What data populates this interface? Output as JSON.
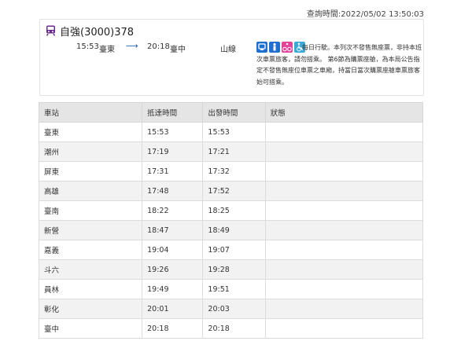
{
  "query_time": "查詢時間:2022/05/02 13:50:03",
  "train": {
    "name": "自強(3000)378",
    "depart_time": "15:53",
    "depart_station": "臺東",
    "arrive_time": "20:18",
    "arrive_station": "臺中",
    "line": "山線",
    "service_icons": [
      "wifi-icon",
      "family-icon",
      "bicycle-icon",
      "wheelchair-icon"
    ],
    "note": "每日行駛。本列次不發售無座票，非持本班次車票旅客，請勿搭乘。 第6節為購票座艙，為本局公告指定不發售無座位車票之車廂，持當日當次購票座艙車票旅客始可搭乘。"
  },
  "table": {
    "headers": [
      "車站",
      "抵達時間",
      "出發時間",
      "狀態"
    ],
    "rows": [
      {
        "station": "臺東",
        "arrive": "15:53",
        "depart": "15:53",
        "status": ""
      },
      {
        "station": "潮州",
        "arrive": "17:19",
        "depart": "17:21",
        "status": ""
      },
      {
        "station": "屏東",
        "arrive": "17:31",
        "depart": "17:32",
        "status": ""
      },
      {
        "station": "高雄",
        "arrive": "17:48",
        "depart": "17:52",
        "status": ""
      },
      {
        "station": "臺南",
        "arrive": "18:22",
        "depart": "18:25",
        "status": ""
      },
      {
        "station": "新營",
        "arrive": "18:47",
        "depart": "18:49",
        "status": ""
      },
      {
        "station": "嘉義",
        "arrive": "19:04",
        "depart": "19:07",
        "status": ""
      },
      {
        "station": "斗六",
        "arrive": "19:26",
        "depart": "19:28",
        "status": ""
      },
      {
        "station": "員林",
        "arrive": "19:49",
        "depart": "19:51",
        "status": ""
      },
      {
        "station": "彰化",
        "arrive": "20:01",
        "depart": "20:03",
        "status": ""
      },
      {
        "station": "臺中",
        "arrive": "20:18",
        "depart": "20:18",
        "status": ""
      }
    ]
  },
  "colors": {
    "train_icon": "#6a2a8c",
    "arrow": "#2a64b8",
    "header_bg": "#e5e5e5",
    "stripe_bg": "#f2f2f2"
  }
}
